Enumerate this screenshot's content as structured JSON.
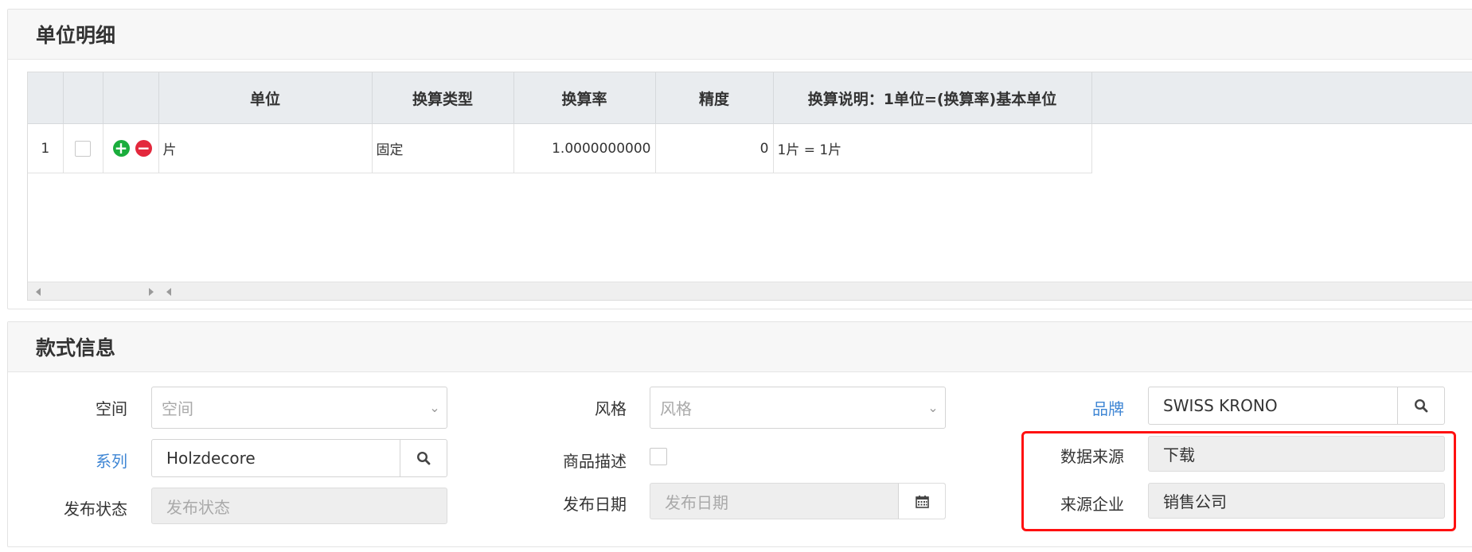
{
  "unit_panel": {
    "title": "单位明细",
    "columns": [
      "单位",
      "换算类型",
      "换算率",
      "精度",
      "换算说明：1单位=(换算率)基本单位"
    ],
    "rows": [
      {
        "index": "1",
        "unit": "片",
        "type": "固定",
        "rate": "1.0000000000",
        "precision": "0",
        "desc": "1片 = 1片"
      }
    ],
    "add_icon": "plus-circle-icon",
    "remove_icon": "minus-circle-icon"
  },
  "style_panel": {
    "title": "款式信息",
    "space": {
      "label": "空间",
      "placeholder": "空间"
    },
    "style": {
      "label": "风格",
      "placeholder": "风格"
    },
    "brand": {
      "label": "品牌",
      "value": "SWISS KRONO"
    },
    "series": {
      "label": "系列",
      "value": "Holzdecore"
    },
    "description": {
      "label": "商品描述"
    },
    "data_source": {
      "label": "数据来源",
      "value": "下载"
    },
    "publish_status": {
      "label": "发布状态",
      "placeholder": "发布状态"
    },
    "publish_date": {
      "label": "发布日期",
      "placeholder": "发布日期"
    },
    "source_company": {
      "label": "来源企业",
      "value": "销售公司"
    }
  },
  "colors": {
    "link": "#3f86d4",
    "highlight": "#ff1010",
    "add": "#1aad3c",
    "remove": "#e3283c"
  }
}
